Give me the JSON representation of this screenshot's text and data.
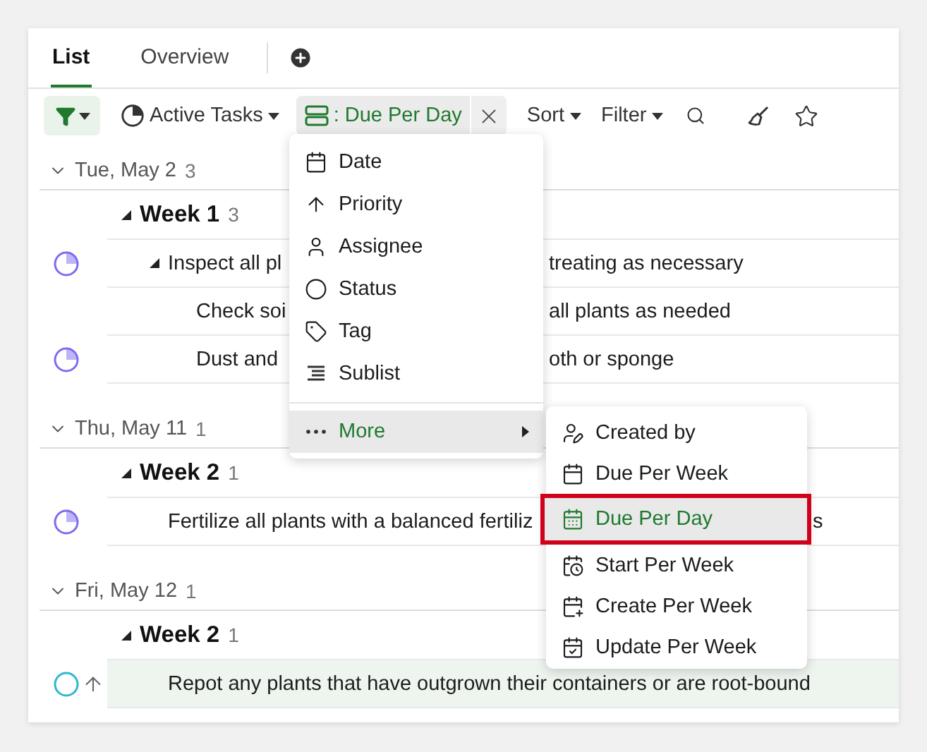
{
  "tabs": [
    {
      "label": "List",
      "selected": true
    },
    {
      "label": "Overview",
      "selected": false
    }
  ],
  "toolbar": {
    "filter_active": true,
    "view": "Active Tasks",
    "group_label": ": Due Per Day",
    "sort": "Sort",
    "filter": "Filter"
  },
  "groups": [
    {
      "date": "Tue, May 2",
      "count": "3",
      "expanded": true,
      "weeks": [
        {
          "label": "Week 1",
          "count": "3",
          "expanded": true,
          "tasks": [
            {
              "kind": "under_menu",
              "status": {
                "color": "#7b6cf0",
                "in_progress": true
              },
              "priority": false,
              "selected": false,
              "expanded": true,
              "text": [
                "Inspect all pl",
                "treating as necessary"
              ],
              "children": [
                {
                  "kind": "under_menu",
                  "priority": false,
                  "selected": false,
                  "text": [
                    "Check soi",
                    "all plants as needed"
                  ]
                },
                {
                  "kind": "under_menu",
                  "status": {
                    "color": "#7b6cf0",
                    "in_progress": true
                  },
                  "priority": false,
                  "selected": false,
                  "text": [
                    "Dust and",
                    "oth or sponge"
                  ]
                }
              ]
            }
          ]
        }
      ]
    },
    {
      "date": "Thu, May 11",
      "count": "1",
      "expanded": true,
      "weeks": [
        {
          "label": "Week 2",
          "count": "1",
          "expanded": true,
          "tasks": [
            {
              "kind": "under_submenu",
              "status": {
                "color": "#7b6cf0",
                "in_progress": true
              },
              "priority": false,
              "selected": false,
              "text": [
                "Fertilize all plants with a balanced fertiliz",
                "s"
              ]
            }
          ]
        }
      ]
    },
    {
      "date": "Fri, May 12",
      "count": "1",
      "expanded": true,
      "weeks": [
        {
          "label": "Week 2",
          "count": "1",
          "expanded": true,
          "tasks": [
            {
              "kind": "plain",
              "status": {
                "color": "#2cb8cf",
                "in_progress": false
              },
              "priority": true,
              "selected": true,
              "text": [
                "Repot any plants that have outgrown their containers or are root-bound"
              ]
            }
          ]
        }
      ]
    }
  ],
  "menu": {
    "items": [
      {
        "label": "Date",
        "selected": false
      },
      {
        "label": "Priority",
        "selected": false
      },
      {
        "label": "Assignee",
        "selected": false
      },
      {
        "label": "Status",
        "selected": false
      },
      {
        "label": "Tag",
        "selected": false
      },
      {
        "label": "Sublist",
        "selected": false
      },
      {
        "label": "More",
        "selected": true,
        "submenu": true
      }
    ]
  },
  "submenu": {
    "items": [
      {
        "label": "Created by",
        "selected": false,
        "annotated": false
      },
      {
        "label": "Due Per Week",
        "selected": false,
        "annotated": false
      },
      {
        "label": "Due Per Day",
        "selected": true,
        "annotated": true
      },
      {
        "label": "Start Per Week",
        "selected": false,
        "annotated": false
      },
      {
        "label": "Create Per Week",
        "selected": false,
        "annotated": false
      },
      {
        "label": "Update Per Week",
        "selected": false,
        "annotated": false
      }
    ]
  }
}
